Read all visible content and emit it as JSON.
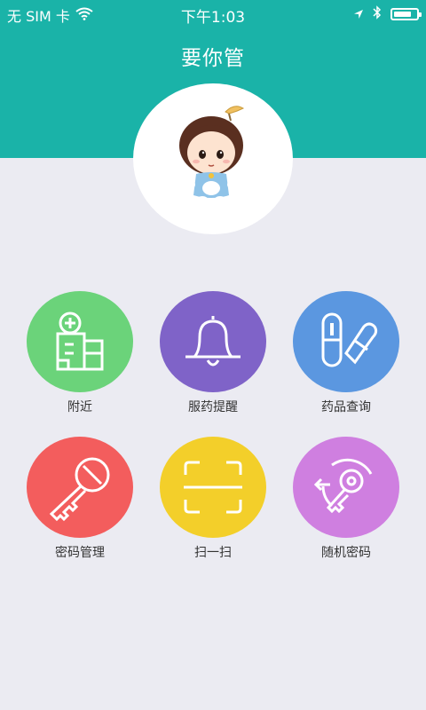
{
  "status_bar": {
    "carrier": "无 SIM 卡",
    "time": "下午1:03",
    "wifi_icon": "wifi-icon",
    "location_icon": "location-arrow-icon",
    "bluetooth_icon": "bluetooth-icon",
    "battery_level": 0.8
  },
  "header": {
    "title": "要你管",
    "background_color": "#1ab3a8"
  },
  "avatar": {
    "icon": "cartoon-girl-avatar"
  },
  "features": [
    {
      "label": "附近",
      "icon": "hospital-building-icon",
      "color": "#6bd37a"
    },
    {
      "label": "服药提醒",
      "icon": "bell-icon",
      "color": "#7f63c8"
    },
    {
      "label": "药品查询",
      "icon": "pill-capsule-icon",
      "color": "#5b97e0"
    },
    {
      "label": "密码管理",
      "icon": "key-icon",
      "color": "#f35d5d"
    },
    {
      "label": "扫一扫",
      "icon": "scan-frame-icon",
      "color": "#f3cf2a"
    },
    {
      "label": "随机密码",
      "icon": "random-key-icon",
      "color": "#cf7fe0"
    }
  ]
}
